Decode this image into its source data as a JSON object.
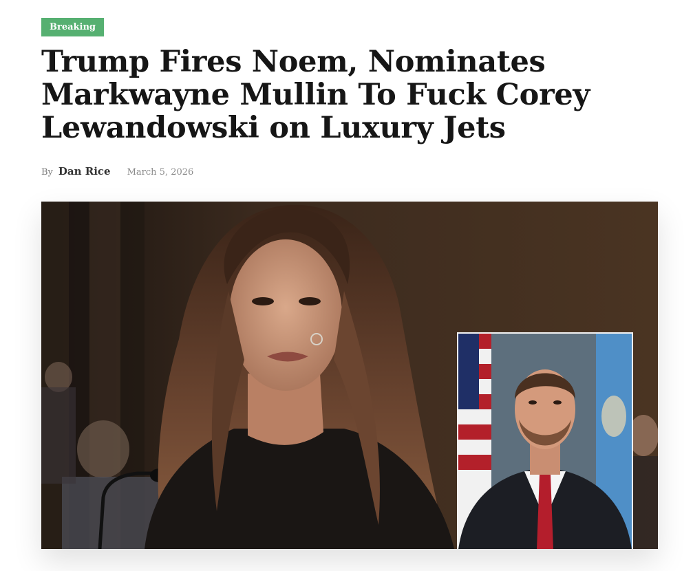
{
  "article": {
    "category": "Breaking",
    "title": "Trump Fires Noem, Nominates Markwayne Mullin To Fuck Corey Lewandowski on Luxury Jets",
    "byline_prefix": "By",
    "author": "Dan Rice",
    "date": "March 5, 2026"
  },
  "colors": {
    "badge_background": "#56b071",
    "headline_text": "#161616",
    "meta_text": "#8a8a8a"
  }
}
